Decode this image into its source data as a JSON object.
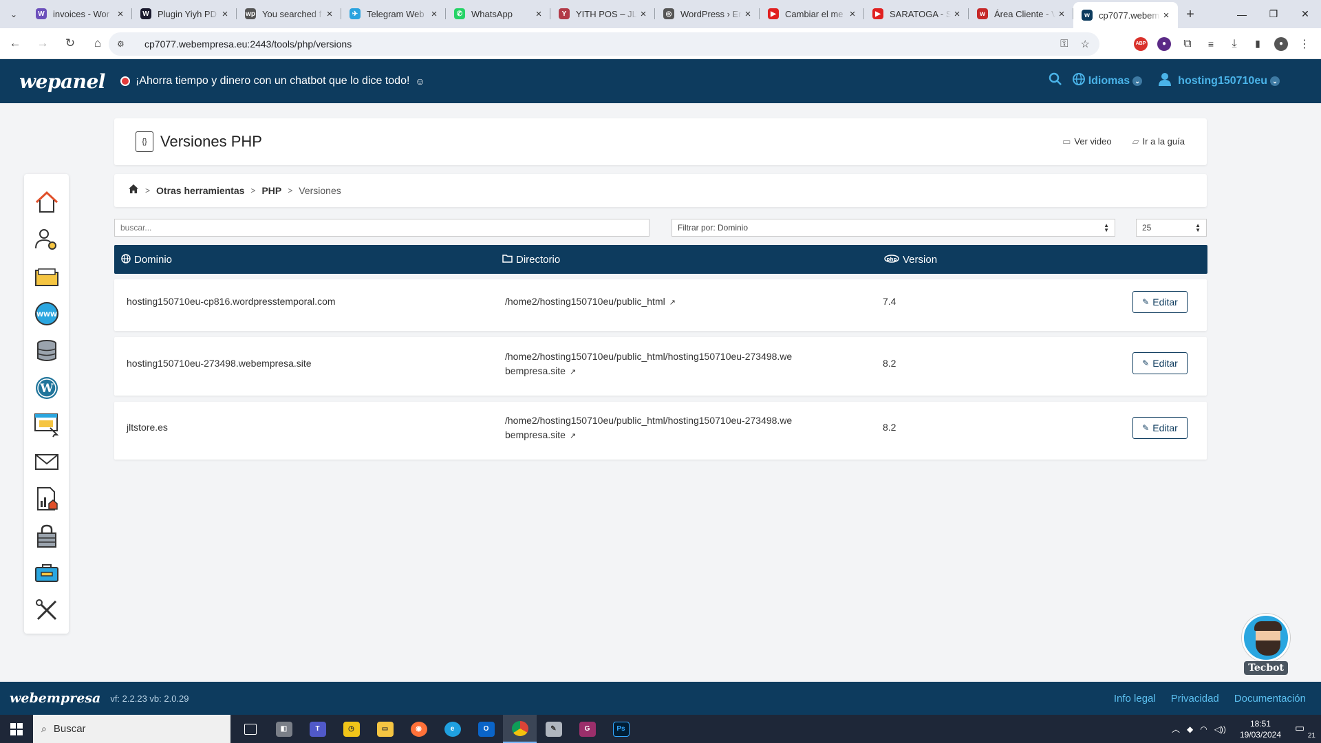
{
  "browser": {
    "tabs": [
      {
        "label": "invoices - Wor",
        "fav_color": "#6b4fbb",
        "fav": "W"
      },
      {
        "label": "Plugin Yiyh PD",
        "fav_color": "#1a1a2e",
        "fav": "W"
      },
      {
        "label": "You searched f",
        "fav_color": "#555555",
        "fav": "wp"
      },
      {
        "label": "Telegram Web",
        "fav_color": "#2aa3df",
        "fav": "✈"
      },
      {
        "label": "WhatsApp",
        "fav_color": "#25d366",
        "fav": "✆"
      },
      {
        "label": "YITH POS – JLT",
        "fav_color": "#b23a48",
        "fav": "Y"
      },
      {
        "label": "WordPress › Er",
        "fav_color": "#555555",
        "fav": "◎"
      },
      {
        "label": "Cambiar el me",
        "fav_color": "#e02020",
        "fav": "▶"
      },
      {
        "label": "SARATOGA - S",
        "fav_color": "#e02020",
        "fav": "▶"
      },
      {
        "label": "Área Cliente - V",
        "fav_color": "#c62828",
        "fav": "w"
      },
      {
        "label": "cp7077.webem",
        "fav_color": "#0d3b5e",
        "fav": "w"
      }
    ],
    "url": "cp7077.webempresa.eu:2443/tools/php/versions"
  },
  "header": {
    "logo": "wepanel",
    "promo": "¡Ahorra tiempo y dinero con un chatbot que lo dice todo!",
    "languages": "Idiomas",
    "user": "hosting150710eu"
  },
  "sidebar": {
    "items": [
      "home-icon",
      "user-settings-icon",
      "folder-icon",
      "www-icon",
      "database-icon",
      "wordpress-icon",
      "site-builder-icon",
      "mail-icon",
      "statistics-icon",
      "security-icon",
      "toolbox-icon",
      "tools-icon"
    ]
  },
  "page": {
    "title": "Versiones PHP",
    "video_link": "Ver video",
    "guide_link": "Ir a la guía"
  },
  "breadcrumb": {
    "items": [
      "Otras herramientas",
      "PHP"
    ],
    "current": "Versiones"
  },
  "filters": {
    "search_placeholder": "buscar...",
    "filter_by": "Filtrar por: Dominio",
    "per_page": "25"
  },
  "table": {
    "headers": {
      "domain": "Dominio",
      "directory": "Directorio",
      "version": "Version"
    },
    "rows": [
      {
        "domain": "hosting150710eu-cp816.wordpresstemporal.com",
        "directory": "/home2/hosting150710eu/public_html",
        "version": "7.4",
        "action": "Editar"
      },
      {
        "domain": "hosting150710eu-273498.webempresa.site",
        "directory": "/home2/hosting150710eu/public_html/hosting150710eu-273498.webempresa.site",
        "version": "8.2",
        "action": "Editar"
      },
      {
        "domain": "jltstore.es",
        "directory": "/home2/hosting150710eu/public_html/hosting150710eu-273498.webempresa.site",
        "version": "8.2",
        "action": "Editar"
      }
    ]
  },
  "tecbot": {
    "label": "Tecbot"
  },
  "footer": {
    "logo": "webempresa",
    "version": "vf: 2.2.23 vb: 2.0.29",
    "links": [
      "Info legal",
      "Privacidad",
      "Documentación"
    ]
  },
  "taskbar": {
    "search": "Buscar",
    "time": "18:51",
    "date": "19/03/2024",
    "notifications": "21"
  },
  "colors": {
    "brand": "#0d3b5e",
    "accent": "#4ab3e8",
    "link": "#5cc0f0"
  }
}
